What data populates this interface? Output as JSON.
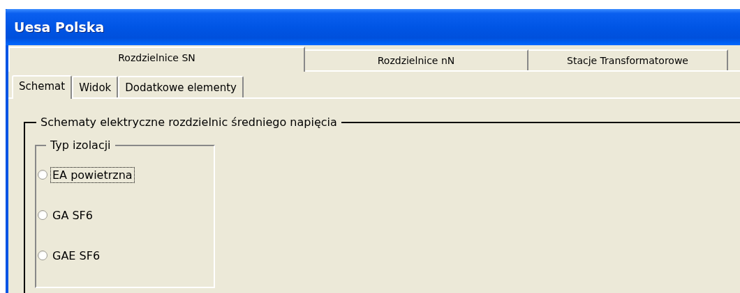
{
  "window": {
    "title": "Uesa Polska"
  },
  "tabs": [
    {
      "label": "Rozdzielnice SN",
      "selected": true
    },
    {
      "label": "Rozdzielnice nN",
      "selected": false
    },
    {
      "label": "Stacje Transformatorowe",
      "selected": false
    }
  ],
  "subtabs": [
    {
      "label": "Schemat",
      "selected": true
    },
    {
      "label": "Widok",
      "selected": false
    },
    {
      "label": "Dodatkowe elementy",
      "selected": false
    }
  ],
  "group": {
    "title": "Schematy elektryczne rozdzielnic średniego napięcia",
    "insulation": {
      "title": "Typ izolacji",
      "options": [
        {
          "label": "EA powietrzna",
          "selected": false,
          "focused": true
        },
        {
          "label": "GA SF6",
          "selected": false,
          "focused": false
        },
        {
          "label": "GAE SF6",
          "selected": false,
          "focused": false
        }
      ]
    }
  }
}
